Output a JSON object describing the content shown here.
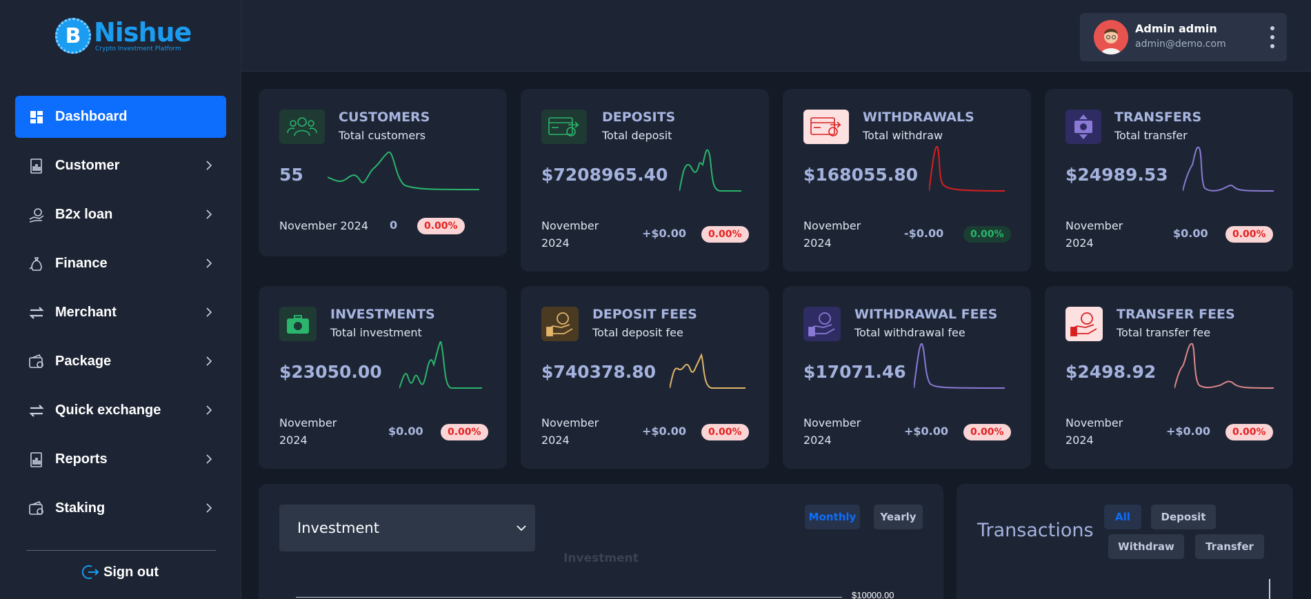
{
  "brand": {
    "name": "Nishue",
    "tagline": "Crypto Investment Platform",
    "coin_letter": "B",
    "color": "#1a9cf0"
  },
  "sidebar": {
    "items": [
      {
        "label": "Dashboard",
        "icon": "dashboard-icon",
        "active": true
      },
      {
        "label": "Customer",
        "icon": "customer-icon"
      },
      {
        "label": "B2x loan",
        "icon": "loan-icon"
      },
      {
        "label": "Finance",
        "icon": "finance-icon"
      },
      {
        "label": "Merchant",
        "icon": "merchant-icon"
      },
      {
        "label": "Package",
        "icon": "package-icon"
      },
      {
        "label": "Quick exchange",
        "icon": "exchange-icon"
      },
      {
        "label": "Reports",
        "icon": "reports-icon"
      },
      {
        "label": "Staking",
        "icon": "staking-icon"
      }
    ],
    "signout": "Sign out"
  },
  "header": {
    "user_name": "Admin admin",
    "user_email": "admin@demo.com"
  },
  "cards": [
    {
      "title": "CUSTOMERS",
      "subtitle": "Total customers",
      "value": "55",
      "period": "November 2024",
      "delta": "0",
      "badge": "0.00%",
      "badge_type": "red",
      "color": "#2bb56d"
    },
    {
      "title": "DEPOSITS",
      "subtitle": "Total deposit",
      "value": "$7208965.40",
      "period": "November 2024",
      "delta": "+$0.00",
      "badge": "0.00%",
      "badge_type": "red",
      "color": "#2bb56d"
    },
    {
      "title": "WITHDRAWALS",
      "subtitle": "Total withdraw",
      "value": "$168055.80",
      "period": "November 2024",
      "delta": "-$0.00",
      "badge": "0.00%",
      "badge_type": "green",
      "color": "#d81f1f"
    },
    {
      "title": "TRANSFERS",
      "subtitle": "Total transfer",
      "value": "$24989.53",
      "period": "November 2024",
      "delta": "$0.00",
      "badge": "0.00%",
      "badge_type": "red",
      "color": "#8a7ad6"
    },
    {
      "title": "INVESTMENTS",
      "subtitle": "Total investment",
      "value": "$23050.00",
      "period": "November 2024",
      "delta": "$0.00",
      "badge": "0.00%",
      "badge_type": "red",
      "color": "#2bb56d"
    },
    {
      "title": "DEPOSIT FEES",
      "subtitle": "Total deposit fee",
      "value": "$740378.80",
      "period": "November 2024",
      "delta": "+$0.00",
      "badge": "0.00%",
      "badge_type": "red",
      "color": "#e2b56a"
    },
    {
      "title": "WITHDRAWAL FEES",
      "subtitle": "Total withdrawal fee",
      "value": "$17071.46",
      "period": "November 2024",
      "delta": "+$0.00",
      "badge": "0.00%",
      "badge_type": "red",
      "color": "#8a7ad6"
    },
    {
      "title": "TRANSFER FEES",
      "subtitle": "Total transfer fee",
      "value": "$2498.92",
      "period": "November 2024",
      "delta": "+$0.00",
      "badge": "0.00%",
      "badge_type": "red",
      "color": "#e0888a"
    }
  ],
  "investment_panel": {
    "select_value": "Investment",
    "tabs": [
      "Monthly",
      "Yearly"
    ],
    "active_tab": "Monthly",
    "chart_title": "Investment",
    "tick_label": "$10000.00"
  },
  "transactions_panel": {
    "title": "Transactions",
    "filters": [
      "All",
      "Deposit",
      "Withdraw",
      "Transfer"
    ],
    "active_filter": "All"
  },
  "colors": {
    "accent": "#0d6efd",
    "bg": "#141b27",
    "card": "#1d2534"
  }
}
